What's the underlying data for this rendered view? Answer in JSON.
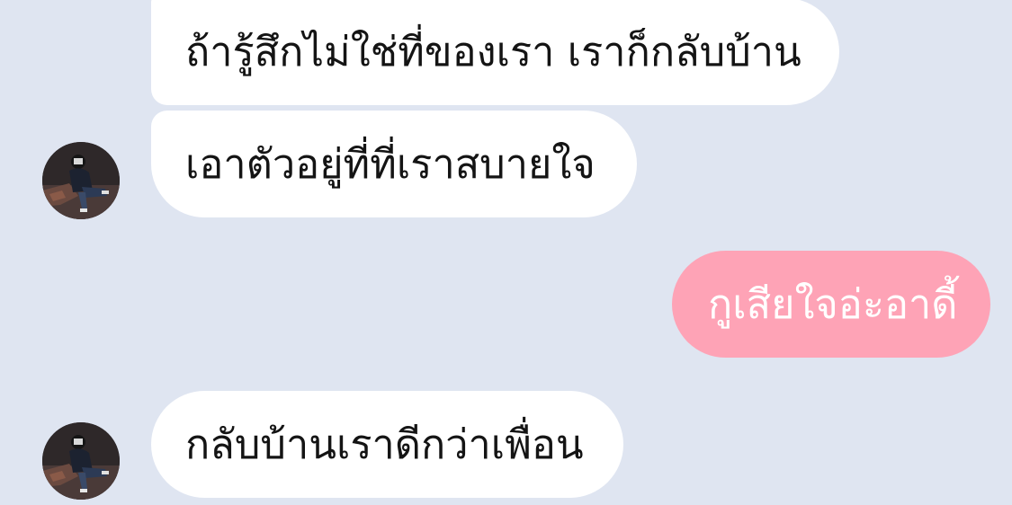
{
  "messages": [
    {
      "direction": "incoming",
      "text": "ถ้ารู้สึกไม่ใช่ที่ของเรา เราก็กลับบ้าน"
    },
    {
      "direction": "incoming",
      "text": "เอาตัวอยู่ที่ที่เราสบายใจ"
    },
    {
      "direction": "outgoing",
      "text": "กูเสียใจอ่ะอาดี้"
    },
    {
      "direction": "incoming",
      "text": "กลับบ้านเราดีกว่าเพื่อน"
    }
  ],
  "colors": {
    "background": "#dfe5f1",
    "incoming_bubble": "#ffffff",
    "outgoing_bubble": "#fea3b6",
    "incoming_text": "#141414",
    "outgoing_text": "#ffffff"
  },
  "icons": {
    "avatar": "user-avatar-photo"
  }
}
